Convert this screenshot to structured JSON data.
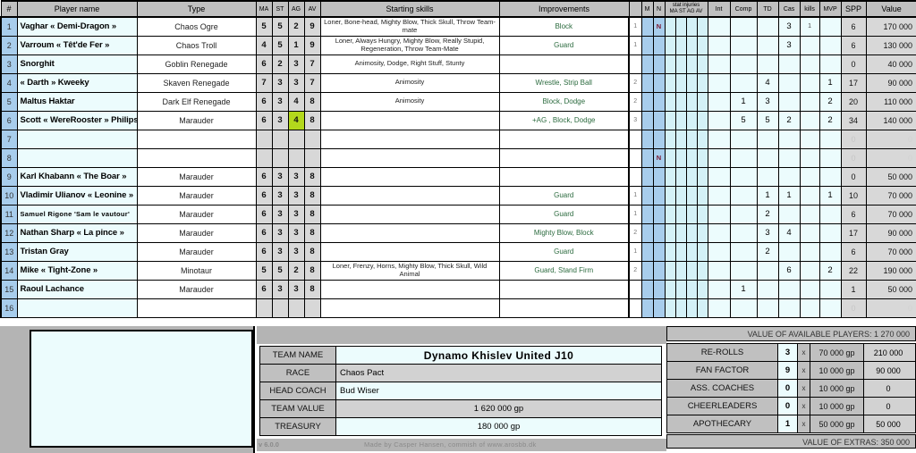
{
  "table": {
    "headers": {
      "num": "#",
      "player_name": "Player name",
      "type": "Type",
      "ma": "MA",
      "st": "ST",
      "ag": "AG",
      "av": "AV",
      "starting_skills": "Starting skills",
      "improvements": "Improvements",
      "skill_count": "",
      "m": "M",
      "n": "N",
      "stat_injuries": "stat injuries",
      "stat_injuries_sub": "MA ST AG AV",
      "int": "Int",
      "comp": "Comp",
      "td": "TD",
      "cas": "Cas",
      "kills": "kills",
      "mvp": "MVP",
      "spp": "SPP",
      "value": "Value"
    },
    "rows": [
      {
        "num": "1",
        "name": "Vaghar « Demi-Dragon »",
        "type": "Chaos Ogre",
        "ma": "5",
        "st": "5",
        "ag": "2",
        "av": "9",
        "skills": "Loner, Bone-head, Mighty Blow, Thick Skull, Throw Team-mate",
        "impr": "Block",
        "cnt": "1",
        "n": "N",
        "int": "",
        "comp": "",
        "td": "",
        "cas": "3",
        "kills": "1",
        "mvp": "",
        "spp": "6",
        "value": "170 000",
        "hl": ""
      },
      {
        "num": "2",
        "name": "Varroum « Têt'de Fer »",
        "type": "Chaos Troll",
        "ma": "4",
        "st": "5",
        "ag": "1",
        "av": "9",
        "skills": "Loner, Always Hungry, Mighty Blow, Really Stupid, Regeneration, Throw Team-Mate",
        "impr": "Guard",
        "cnt": "1",
        "n": "",
        "int": "",
        "comp": "",
        "td": "",
        "cas": "3",
        "kills": "",
        "mvp": "",
        "spp": "6",
        "value": "130 000",
        "hl": ""
      },
      {
        "num": "3",
        "name": "Snorghit",
        "type": "Goblin Renegade",
        "ma": "6",
        "st": "2",
        "ag": "3",
        "av": "7",
        "skills": "Animosity, Dodge, Right Stuff, Stunty",
        "impr": "",
        "cnt": "",
        "n": "",
        "int": "",
        "comp": "",
        "td": "",
        "cas": "",
        "kills": "",
        "mvp": "",
        "spp": "0",
        "value": "40 000",
        "hl": ""
      },
      {
        "num": "4",
        "name": "« Darth » Kweeky",
        "type": "Skaven Renegade",
        "ma": "7",
        "st": "3",
        "ag": "3",
        "av": "7",
        "skills": "Animosity",
        "impr": "Wrestle, Strip Ball",
        "cnt": "2",
        "n": "",
        "int": "",
        "comp": "",
        "td": "4",
        "cas": "",
        "kills": "",
        "mvp": "1",
        "spp": "17",
        "value": "90 000",
        "hl": ""
      },
      {
        "num": "5",
        "name": "Maltus Haktar",
        "type": "Dark Elf Renegade",
        "ma": "6",
        "st": "3",
        "ag": "4",
        "av": "8",
        "skills": "Animosity",
        "impr": "Block, Dodge",
        "cnt": "2",
        "n": "",
        "int": "",
        "comp": "1",
        "td": "3",
        "cas": "",
        "kills": "",
        "mvp": "2",
        "spp": "20",
        "value": "110 000",
        "hl": ""
      },
      {
        "num": "6",
        "name": "Scott « WereRooster » Philips",
        "type": "Marauder",
        "ma": "6",
        "st": "3",
        "ag": "4",
        "av": "8",
        "skills": "",
        "impr": "+AG , Block, Dodge",
        "cnt": "3",
        "n": "",
        "int": "",
        "comp": "5",
        "td": "5",
        "cas": "2",
        "kills": "",
        "mvp": "2",
        "spp": "34",
        "value": "140 000",
        "hl": "ag"
      },
      {
        "num": "7",
        "name": "",
        "type": "",
        "ma": "",
        "st": "",
        "ag": "",
        "av": "",
        "skills": "",
        "impr": "",
        "cnt": "",
        "n": "",
        "int": "",
        "comp": "",
        "td": "",
        "cas": "",
        "kills": "",
        "mvp": "",
        "spp": "0",
        "value": "0",
        "hl": "",
        "dim": true
      },
      {
        "num": "8",
        "name": "",
        "type": "",
        "ma": "",
        "st": "",
        "ag": "",
        "av": "",
        "skills": "",
        "impr": "",
        "cnt": "",
        "n": "N",
        "int": "",
        "comp": "",
        "td": "",
        "cas": "",
        "kills": "",
        "mvp": "",
        "spp": "0",
        "value": "0",
        "hl": "",
        "dim": true
      },
      {
        "num": "9",
        "name": "Karl Khabann « The Boar »",
        "type": "Marauder",
        "ma": "6",
        "st": "3",
        "ag": "3",
        "av": "8",
        "skills": "",
        "impr": "",
        "cnt": "",
        "n": "",
        "int": "",
        "comp": "",
        "td": "",
        "cas": "",
        "kills": "",
        "mvp": "",
        "spp": "0",
        "value": "50 000",
        "hl": ""
      },
      {
        "num": "10",
        "name": "Vladimir Ulianov « Leonine »",
        "type": "Marauder",
        "ma": "6",
        "st": "3",
        "ag": "3",
        "av": "8",
        "skills": "",
        "impr": "Guard",
        "cnt": "1",
        "n": "",
        "int": "",
        "comp": "",
        "td": "1",
        "cas": "1",
        "kills": "",
        "mvp": "1",
        "spp": "10",
        "value": "70 000",
        "hl": ""
      },
      {
        "num": "11",
        "name": "Samuel Rigone 'Sam le vautour'",
        "type": "Marauder",
        "ma": "6",
        "st": "3",
        "ag": "3",
        "av": "8",
        "skills": "",
        "impr": "Guard",
        "cnt": "1",
        "n": "",
        "int": "",
        "comp": "",
        "td": "2",
        "cas": "",
        "kills": "",
        "mvp": "",
        "spp": "6",
        "value": "70 000",
        "hl": "",
        "tight": true
      },
      {
        "num": "12",
        "name": "Nathan Sharp « La pince »",
        "type": "Marauder",
        "ma": "6",
        "st": "3",
        "ag": "3",
        "av": "8",
        "skills": "",
        "impr": "Mighty Blow, Block",
        "cnt": "2",
        "n": "",
        "int": "",
        "comp": "",
        "td": "3",
        "cas": "4",
        "kills": "",
        "mvp": "",
        "spp": "17",
        "value": "90 000",
        "hl": ""
      },
      {
        "num": "13",
        "name": "Tristan Gray",
        "type": "Marauder",
        "ma": "6",
        "st": "3",
        "ag": "3",
        "av": "8",
        "skills": "",
        "impr": "Guard",
        "cnt": "1",
        "n": "",
        "int": "",
        "comp": "",
        "td": "2",
        "cas": "",
        "kills": "",
        "mvp": "",
        "spp": "6",
        "value": "70 000",
        "hl": ""
      },
      {
        "num": "14",
        "name": "Mike « Tight-Zone »",
        "type": "Minotaur",
        "ma": "5",
        "st": "5",
        "ag": "2",
        "av": "8",
        "skills": "Loner, Frenzy, Horns, Mighty Blow, Thick Skull, Wild Animal",
        "impr": "Guard, Stand Firm",
        "cnt": "2",
        "n": "",
        "int": "",
        "comp": "",
        "td": "",
        "cas": "6",
        "kills": "",
        "mvp": "2",
        "spp": "22",
        "value": "190 000",
        "hl": ""
      },
      {
        "num": "15",
        "name": "Raoul Lachance",
        "type": "Marauder",
        "ma": "6",
        "st": "3",
        "ag": "3",
        "av": "8",
        "skills": "",
        "impr": "",
        "cnt": "",
        "n": "",
        "int": "",
        "comp": "1",
        "td": "",
        "cas": "",
        "kills": "",
        "mvp": "",
        "spp": "1",
        "value": "50 000",
        "hl": ""
      },
      {
        "num": "16",
        "name": "",
        "type": "",
        "ma": "",
        "st": "",
        "ag": "",
        "av": "",
        "skills": "",
        "impr": "",
        "cnt": "",
        "n": "",
        "int": "",
        "comp": "",
        "td": "",
        "cas": "",
        "kills": "",
        "mvp": "",
        "spp": "0",
        "value": "0",
        "hl": "",
        "dim": true
      }
    ]
  },
  "team_info": {
    "team_name_label": "TEAM NAME",
    "team_name": "Dynamo  Khislev  United  J10",
    "race_label": "RACE",
    "race": "Chaos Pact",
    "head_coach_label": "HEAD COACH",
    "head_coach": "Bud Wiser",
    "team_value_label": "TEAM VALUE",
    "team_value": "1 620 000  gp",
    "treasury_label": "TREASURY",
    "treasury": "180 000  gp"
  },
  "extras": {
    "value_of_available_players": "VALUE OF AVAILABLE PLAYERS: 1 270 000",
    "value_of_extras": "VALUE OF EXTRAS:   350 000",
    "multiplier": "x",
    "rows": [
      {
        "label": "RE-ROLLS",
        "qty": "3",
        "cost": "70 000 gp",
        "total": "210 000"
      },
      {
        "label": "FAN FACTOR",
        "qty": "9",
        "cost": "10 000 gp",
        "total": "90 000"
      },
      {
        "label": "ASS. COACHES",
        "qty": "0",
        "cost": "10 000 gp",
        "total": "0"
      },
      {
        "label": "CHEERLEADERS",
        "qty": "0",
        "cost": "10 000 gp",
        "total": "0"
      },
      {
        "label": "APOTHECARY",
        "qty": "1",
        "cost": "50 000 gp",
        "total": "50 000"
      }
    ]
  },
  "footer": {
    "version": "v 6.0.0",
    "credit": "Made by  Casper Hansen,   commish of  www.arosbb.dk"
  },
  "colors": {
    "header_gray": "#c0c0c0",
    "row_blue": "#a8cdec",
    "name_cyan": "#ecfcfd",
    "stat_gray": "#d8d8d8",
    "improvement_green": "#2c6b3f",
    "highlight_green": "#b3d81c",
    "injury_cyan": "#d4f1f7",
    "panel_gray": "#b4b4b4"
  }
}
